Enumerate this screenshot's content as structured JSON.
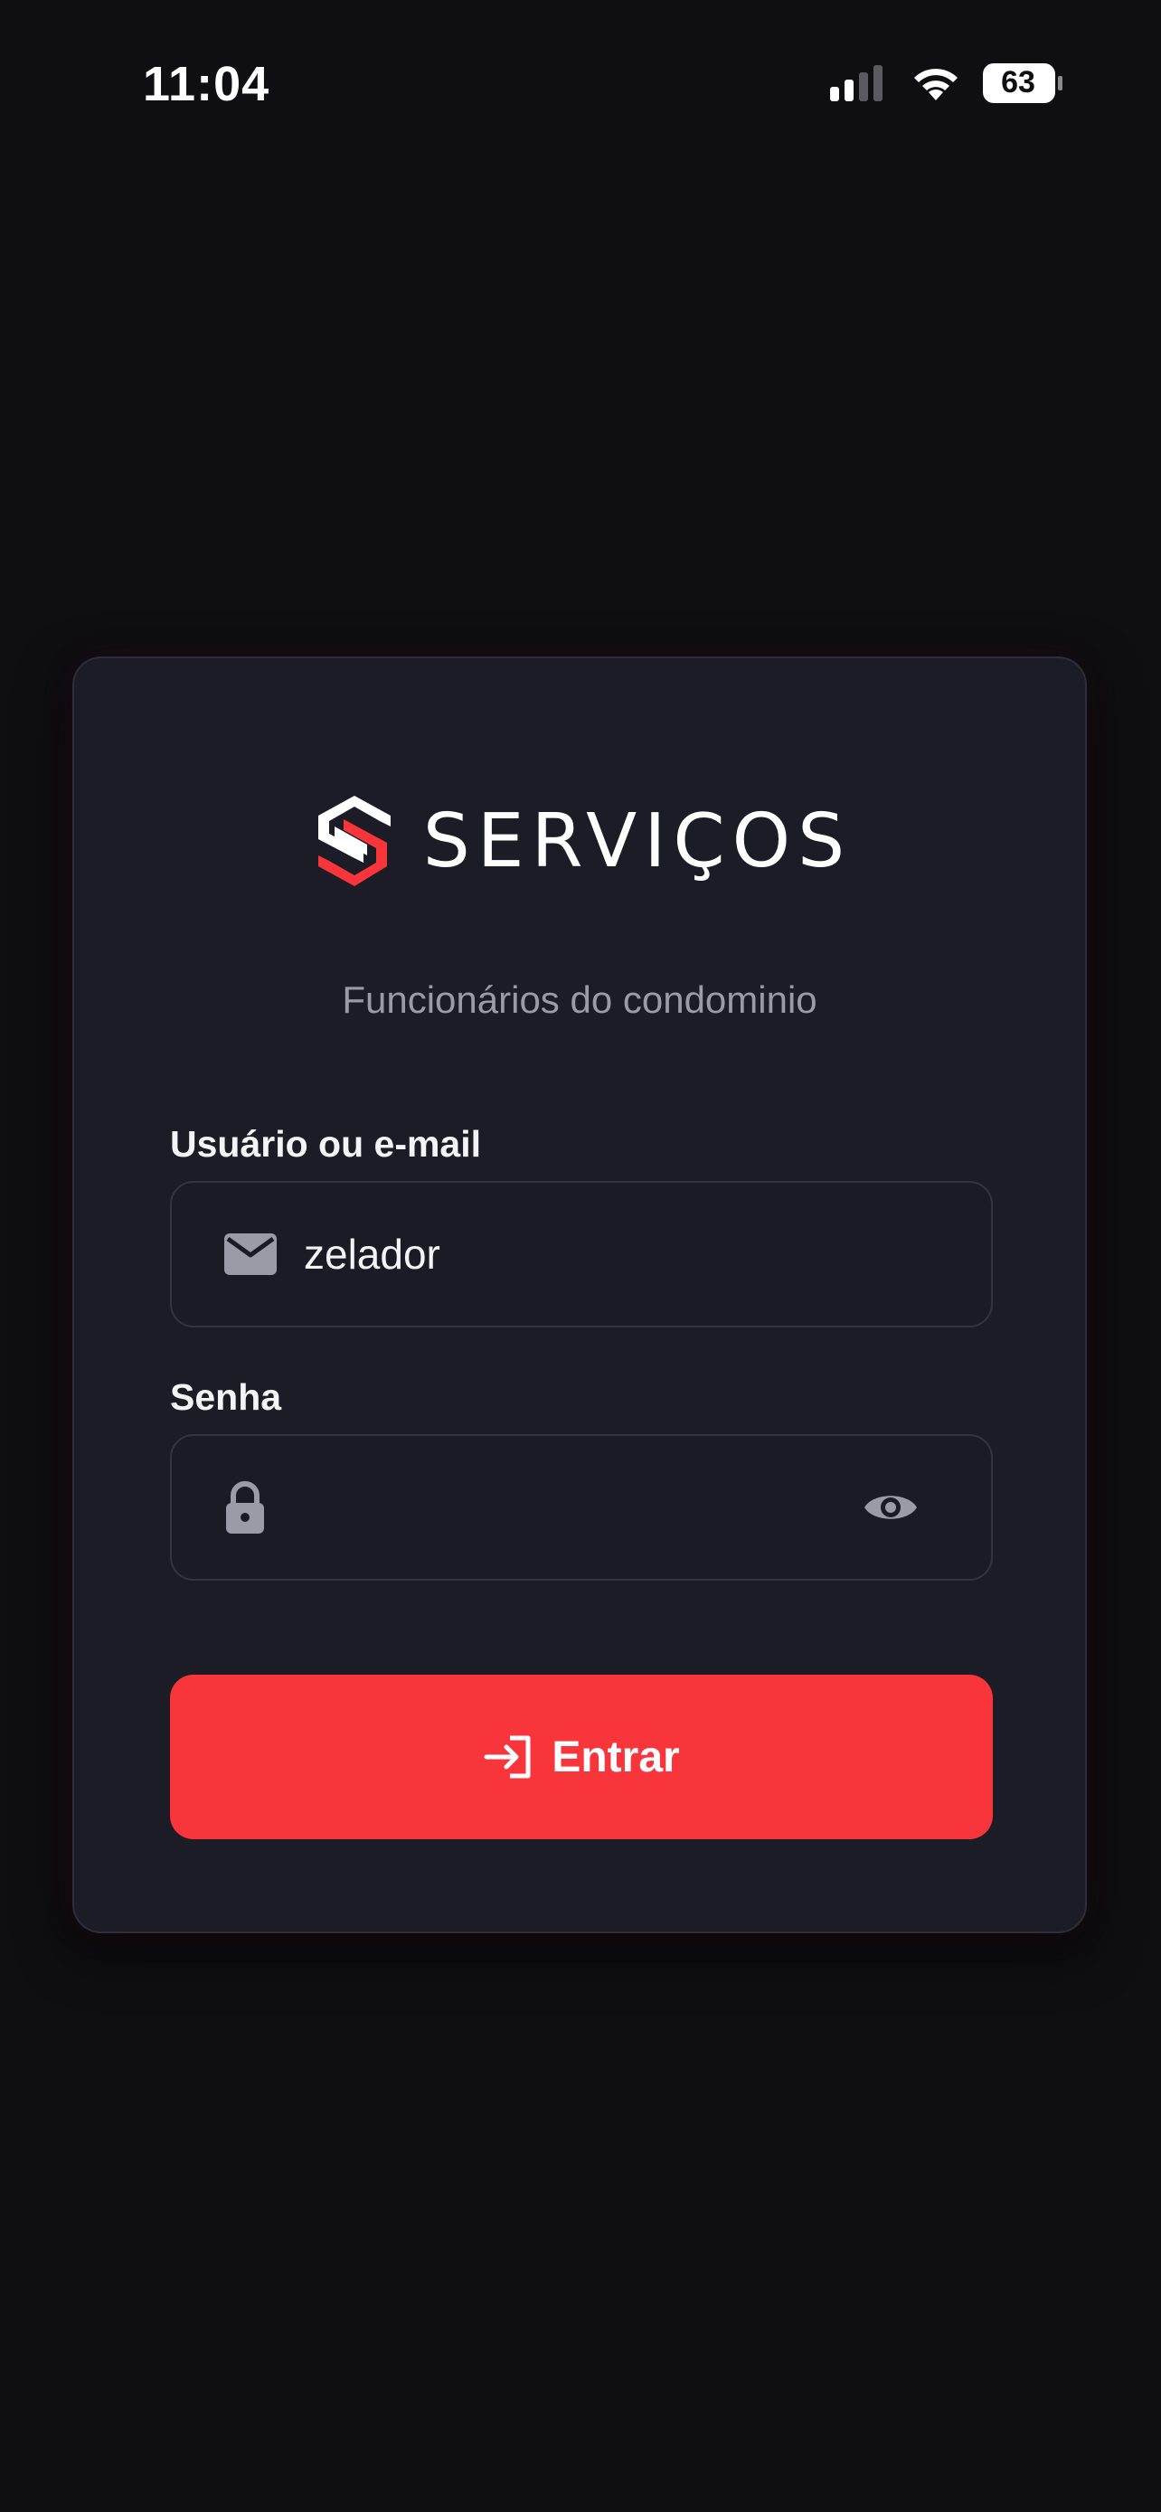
{
  "status_bar": {
    "time": "11:04",
    "battery_level": "63"
  },
  "brand": {
    "name": "SERVIÇOS",
    "subtitle": "Funcionários do condominio",
    "accent_color": "#f8353b"
  },
  "form": {
    "username": {
      "label": "Usuário ou e-mail",
      "value": "zelador",
      "icon": "mail-icon"
    },
    "password": {
      "label": "Senha",
      "value": "",
      "icon": "lock-icon",
      "toggle_icon": "eye-icon"
    },
    "submit": {
      "label": "Entrar",
      "icon": "login-icon"
    }
  }
}
